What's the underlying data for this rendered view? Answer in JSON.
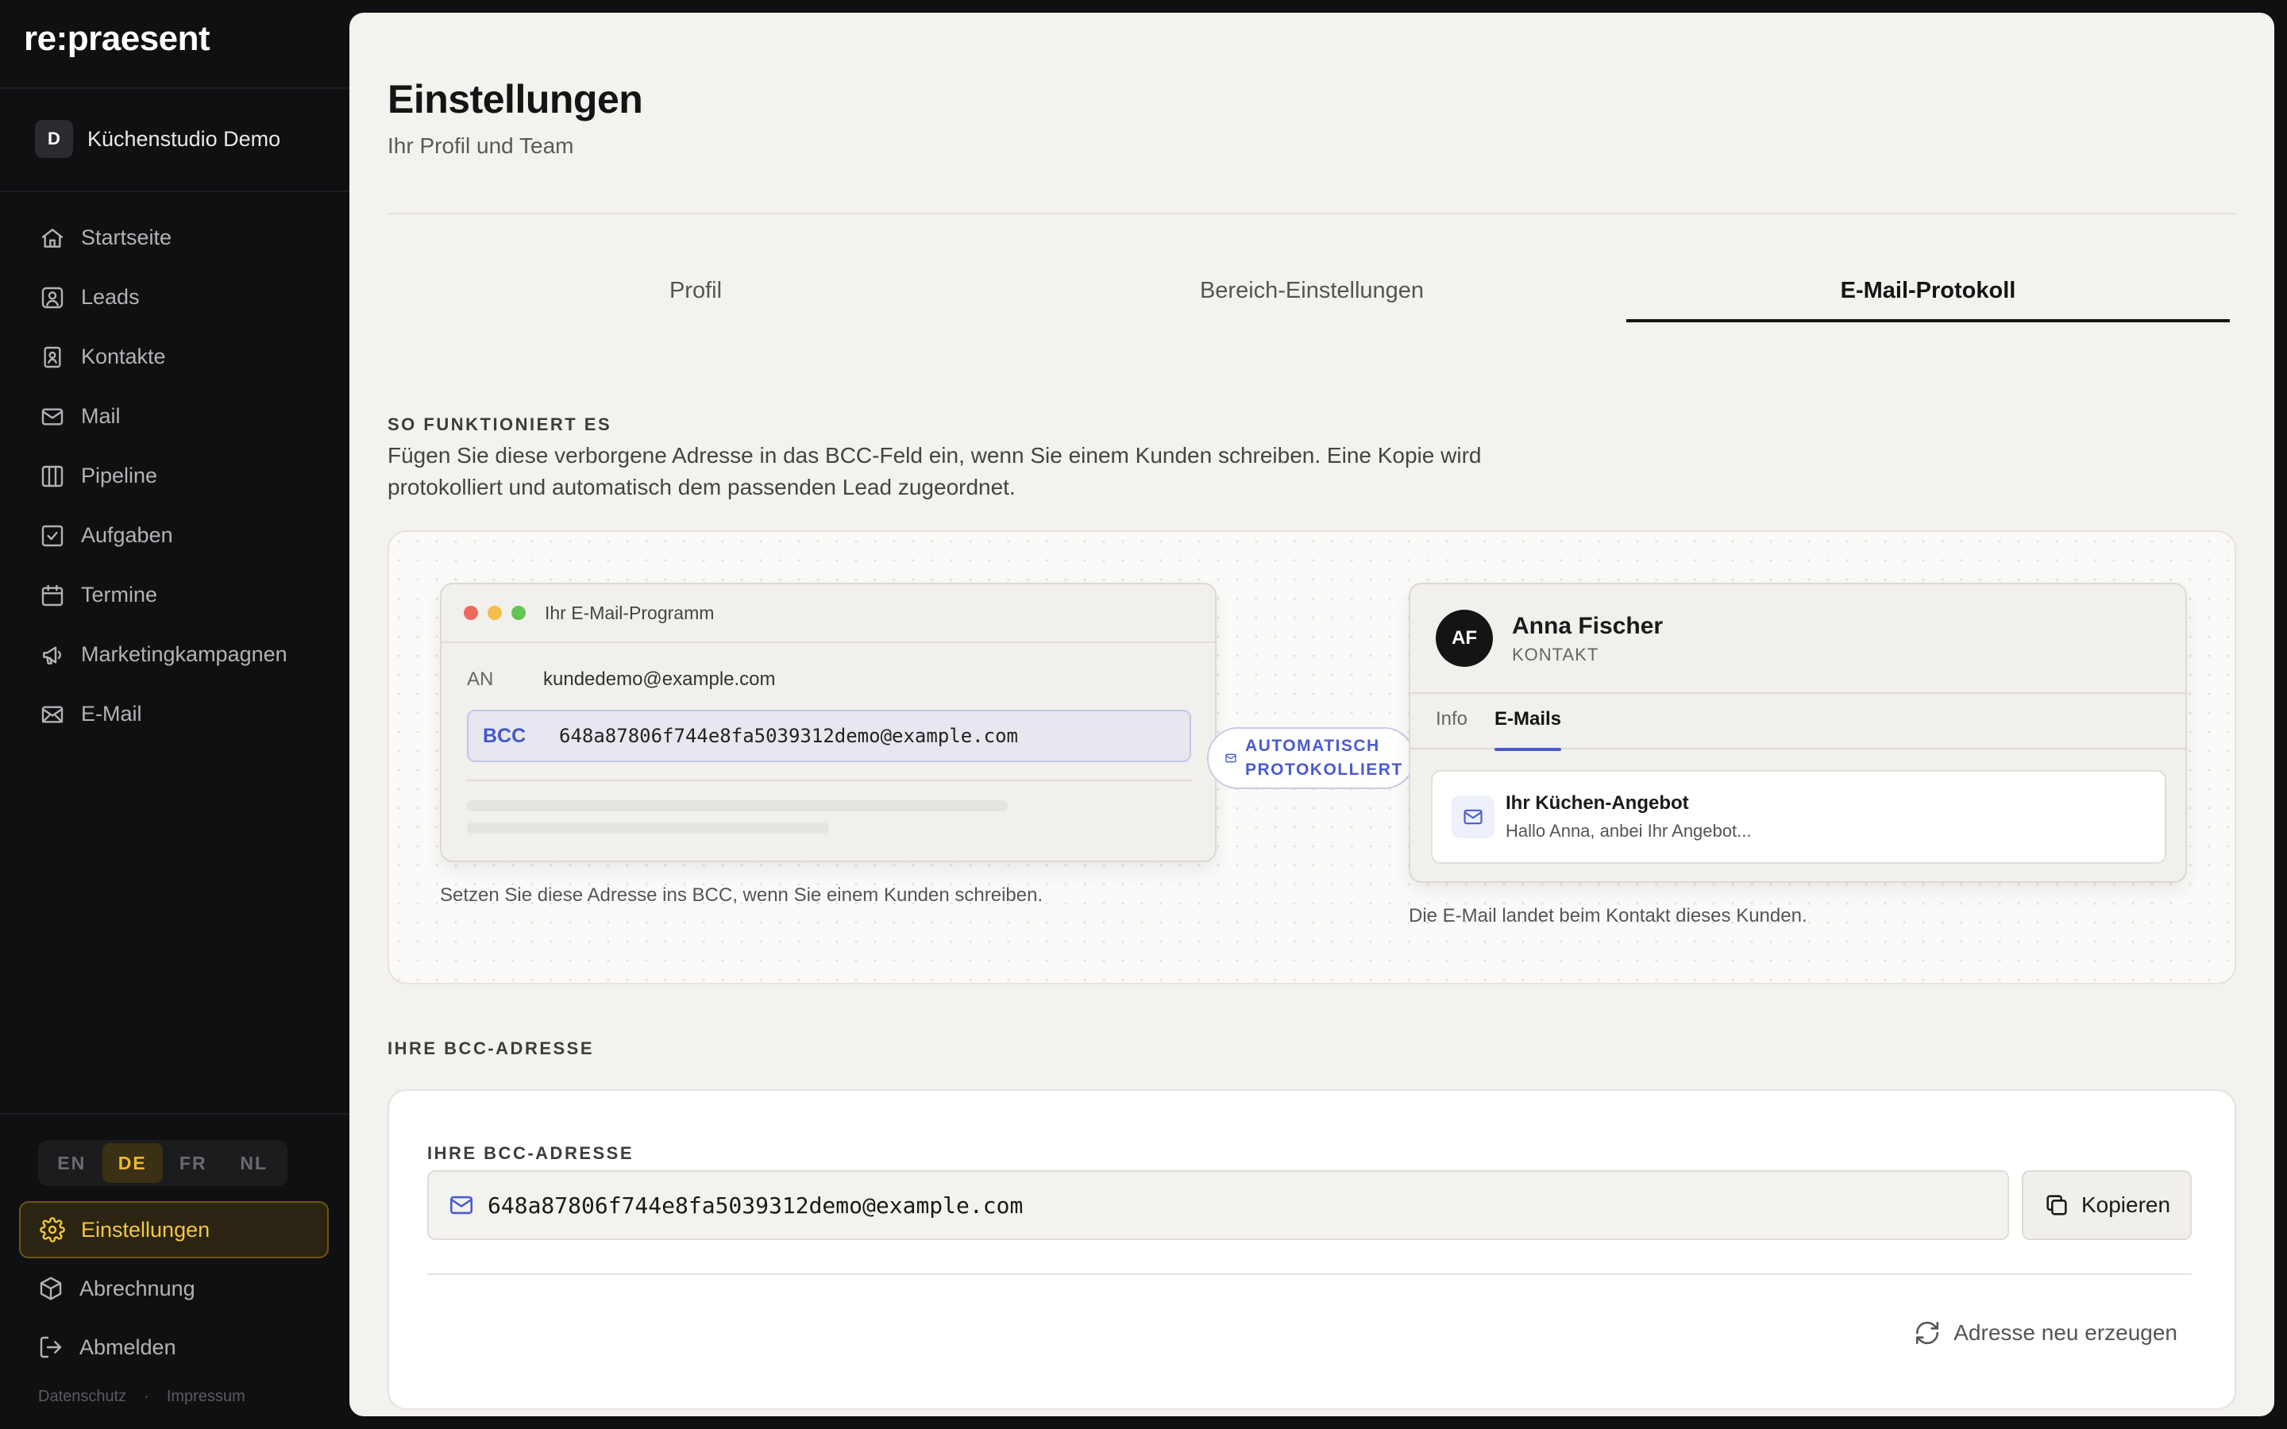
{
  "app": {
    "brand": "re:praesent"
  },
  "workspace": {
    "initial": "D",
    "name": "Küchenstudio Demo"
  },
  "sidebar": {
    "items": [
      {
        "label": "Startseite",
        "icon": "home-icon"
      },
      {
        "label": "Leads",
        "icon": "user-square-icon"
      },
      {
        "label": "Kontakte",
        "icon": "contact-book-icon"
      },
      {
        "label": "Mail",
        "icon": "mail-icon"
      },
      {
        "label": "Pipeline",
        "icon": "columns-icon"
      },
      {
        "label": "Aufgaben",
        "icon": "checkbox-icon"
      },
      {
        "label": "Termine",
        "icon": "calendar-icon"
      },
      {
        "label": "Marketingkampagnen",
        "icon": "megaphone-icon"
      },
      {
        "label": "E-Mail",
        "icon": "mail-open-icon"
      }
    ],
    "languages": [
      "EN",
      "DE",
      "FR",
      "NL"
    ],
    "active_language": "DE",
    "bottom": [
      {
        "label": "Einstellungen",
        "icon": "gear-icon",
        "active": true
      },
      {
        "label": "Abrechnung",
        "icon": "package-icon"
      },
      {
        "label": "Abmelden",
        "icon": "logout-icon"
      }
    ],
    "footer": {
      "privacy": "Datenschutz",
      "dot": "·",
      "imprint": "Impressum"
    }
  },
  "header": {
    "title": "Einstellungen",
    "subtitle": "Ihr Profil und Team"
  },
  "tabs": [
    "Profil",
    "Bereich-Einstellungen",
    "E-Mail-Protokoll"
  ],
  "active_tab": "E-Mail-Protokoll",
  "how": {
    "label": "SO FUNKTIONIERT ES",
    "text": "Fügen Sie diese verborgene Adresse in das BCC-Feld ein, wenn Sie einem Kunden schreiben. Eine Kopie wird protokolliert und automatisch dem passenden Lead zugeordnet."
  },
  "illustration": {
    "mail_window": {
      "title": "Ihr E-Mail-Programm",
      "to_label": "AN",
      "to_value": "kundedemo@example.com",
      "bcc_label": "BCC",
      "bcc_value": "648a87806f744e8fa5039312demo@example.com",
      "caption": "Setzen Sie diese Adresse ins BCC, wenn Sie einem Kunden schreiben."
    },
    "pill": {
      "line1": "AUTOMATISCH",
      "line2": "PROTOKOLLIERT"
    },
    "contact": {
      "initials": "AF",
      "name": "Anna Fischer",
      "role": "KONTAKT",
      "tab_info": "Info",
      "tab_emails": "E-Mails",
      "mail_subject": "Ihr Küchen-Angebot",
      "mail_preview": "Hallo Anna, anbei Ihr Angebot...",
      "caption": "Die E-Mail landet beim Kontakt dieses Kunden."
    }
  },
  "bcc_section": {
    "section_label": "IHRE BCC-ADRESSE",
    "field_label": "IHRE BCC-ADRESSE",
    "address": "648a87806f744e8fa5039312demo@example.com",
    "copy_label": "Kopieren",
    "regenerate_label": "Adresse neu erzeugen"
  },
  "colors": {
    "accent": "#4a5bd0",
    "active_nav": "#f3c73d",
    "sidebar_bg": "#0f1012"
  }
}
